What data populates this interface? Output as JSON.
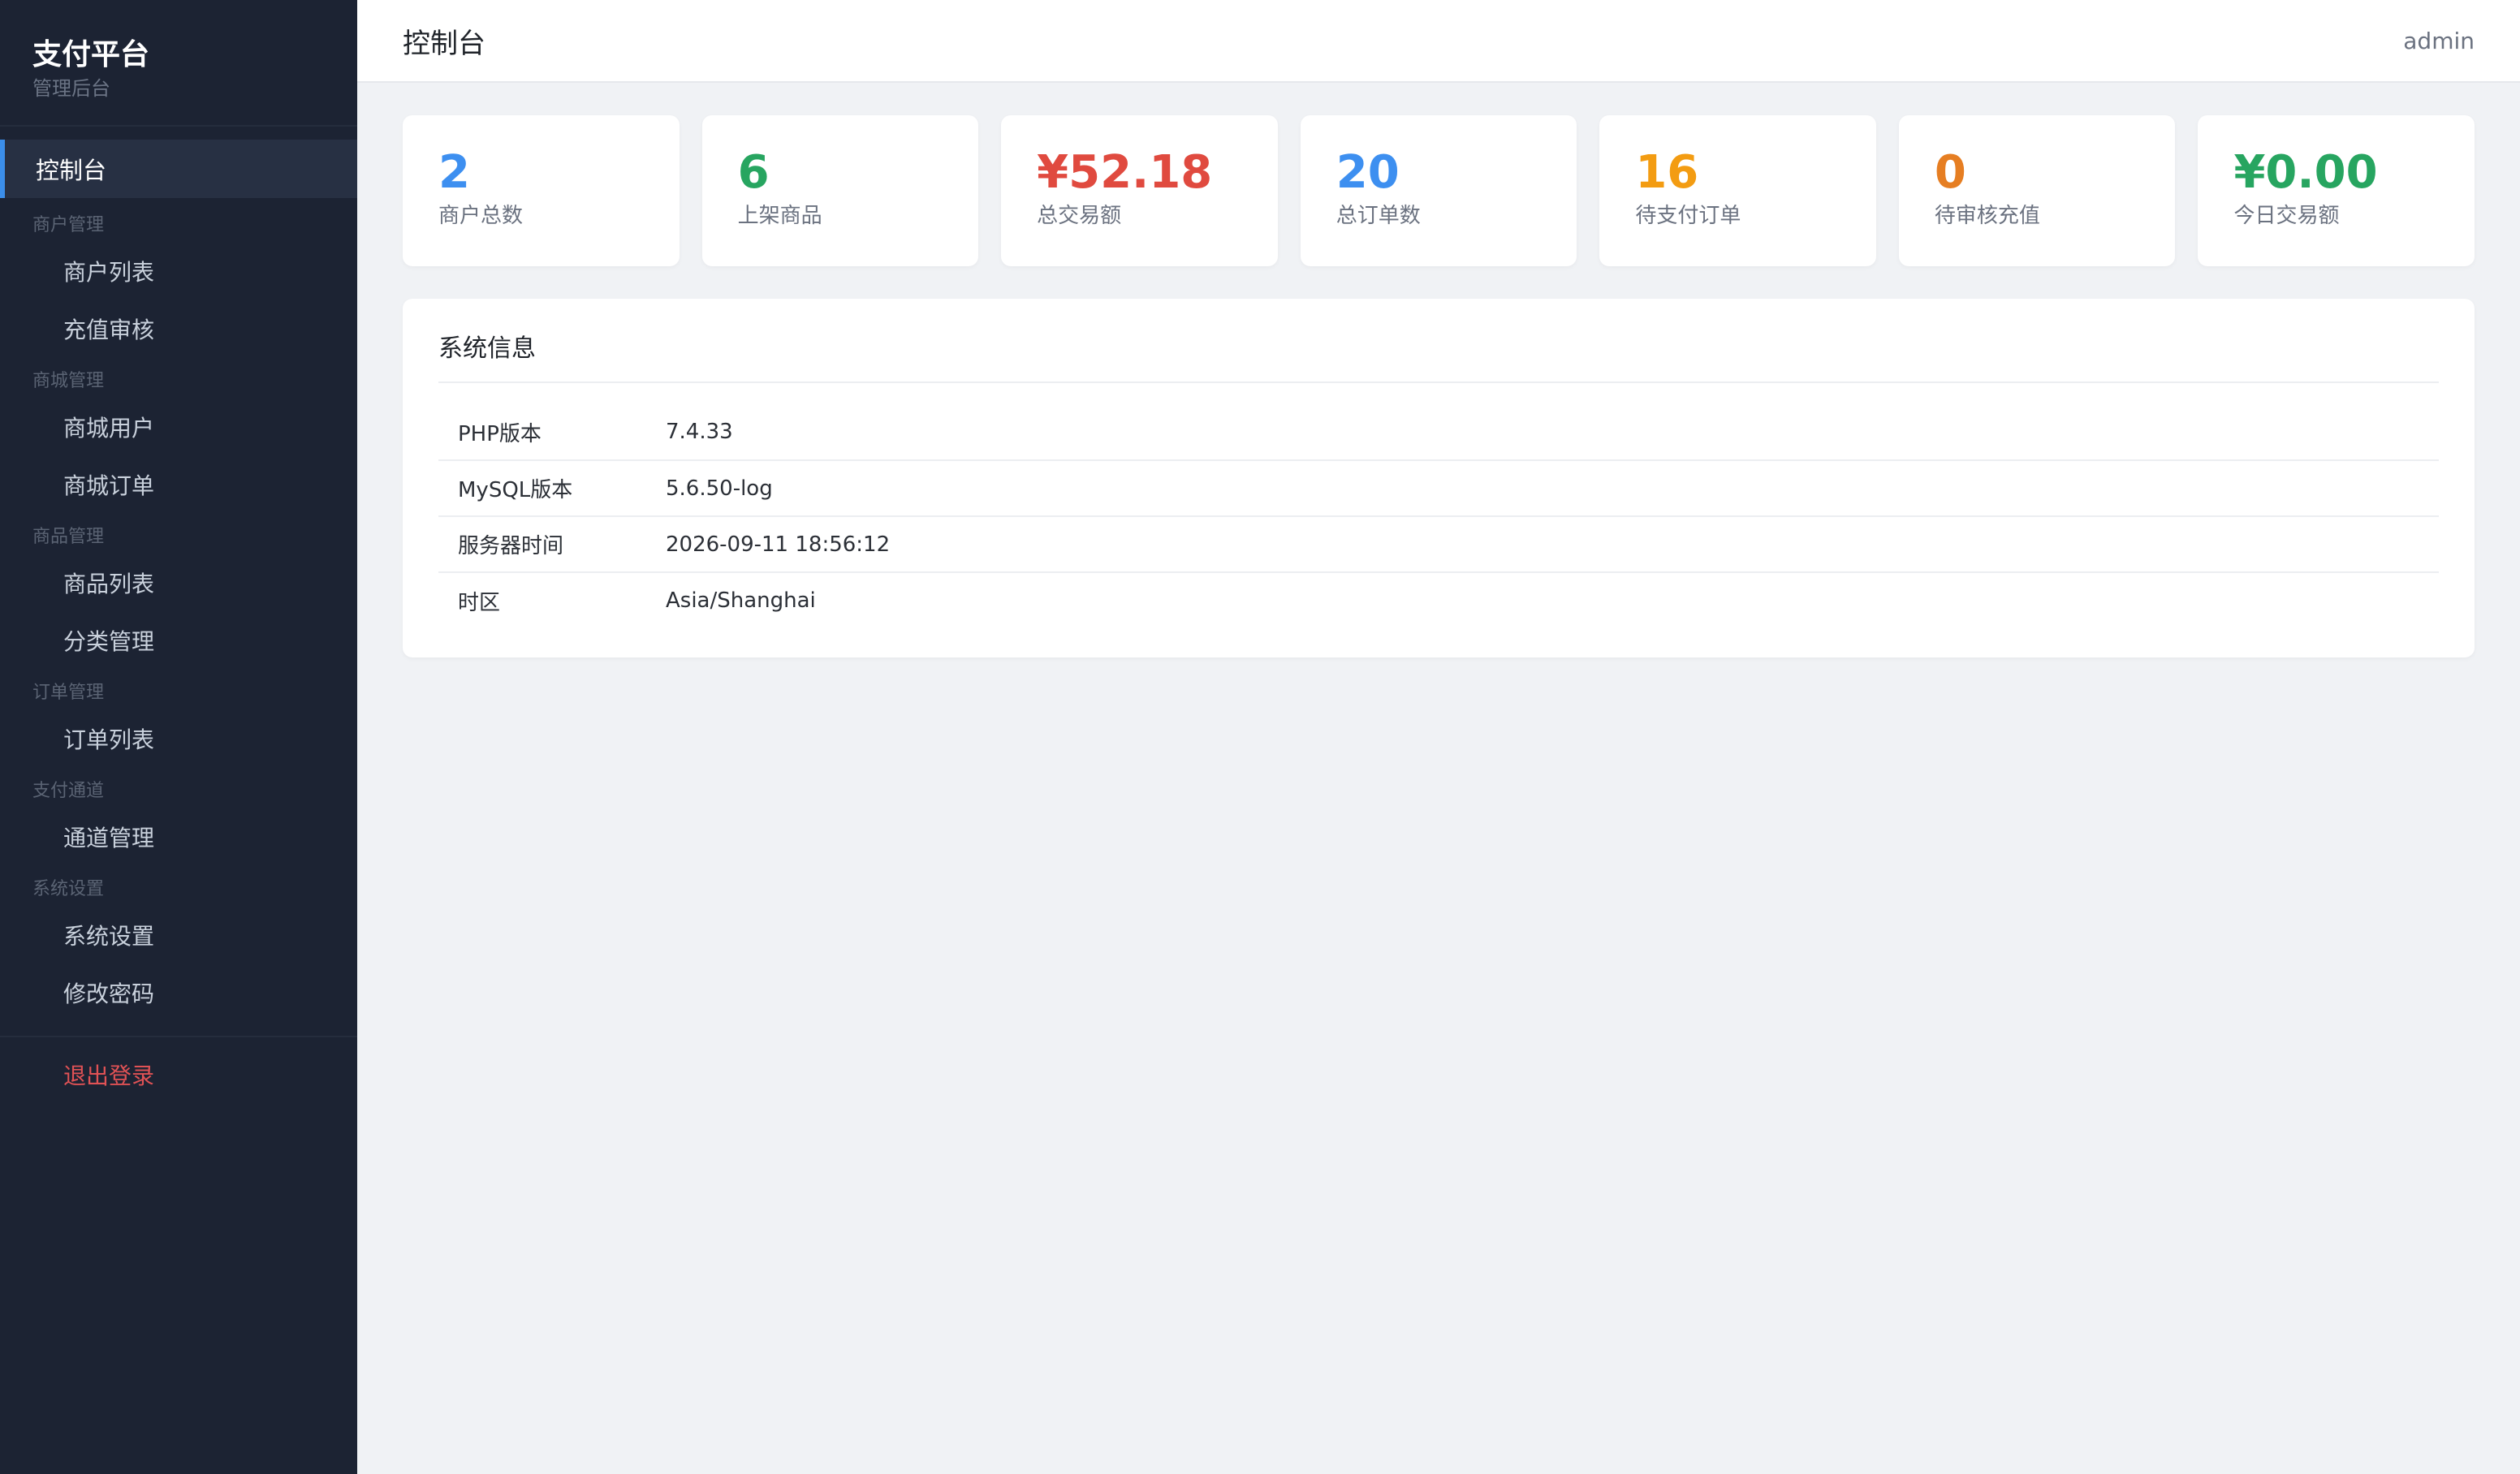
{
  "sidebar": {
    "brand_title": "支付平台",
    "brand_subtitle": "管理后台",
    "active_item": "控制台",
    "groups": [
      {
        "label": "商户管理",
        "items": [
          "商户列表",
          "充值审核"
        ]
      },
      {
        "label": "商城管理",
        "items": [
          "商城用户",
          "商城订单"
        ]
      },
      {
        "label": "商品管理",
        "items": [
          "商品列表",
          "分类管理"
        ]
      },
      {
        "label": "订单管理",
        "items": [
          "订单列表"
        ]
      },
      {
        "label": "支付通道",
        "items": [
          "通道管理"
        ]
      },
      {
        "label": "系统设置",
        "items": [
          "系统设置",
          "修改密码"
        ]
      }
    ],
    "logout": "退出登录"
  },
  "header": {
    "title": "控制台",
    "user": "admin"
  },
  "stats": [
    {
      "value": "2",
      "label": "商户总数",
      "color": "#3d8ff0"
    },
    {
      "value": "6",
      "label": "上架商品",
      "color": "#27a560"
    },
    {
      "value": "¥52.18",
      "label": "总交易额",
      "color": "#e04a3f"
    },
    {
      "value": "20",
      "label": "总订单数",
      "color": "#3d8ff0"
    },
    {
      "value": "16",
      "label": "待支付订单",
      "color": "#f39c12"
    },
    {
      "value": "0",
      "label": "待审核充值",
      "color": "#e67e22"
    },
    {
      "value": "¥0.00",
      "label": "今日交易额",
      "color": "#27a560"
    }
  ],
  "system_info": {
    "title": "系统信息",
    "rows": [
      {
        "key": "PHP版本",
        "value": "7.4.33"
      },
      {
        "key": "MySQL版本",
        "value": "5.6.50-log"
      },
      {
        "key": "服务器时间",
        "value": "2026-09-11 18:56:12"
      },
      {
        "key": "时区",
        "value": "Asia/Shanghai"
      }
    ]
  }
}
